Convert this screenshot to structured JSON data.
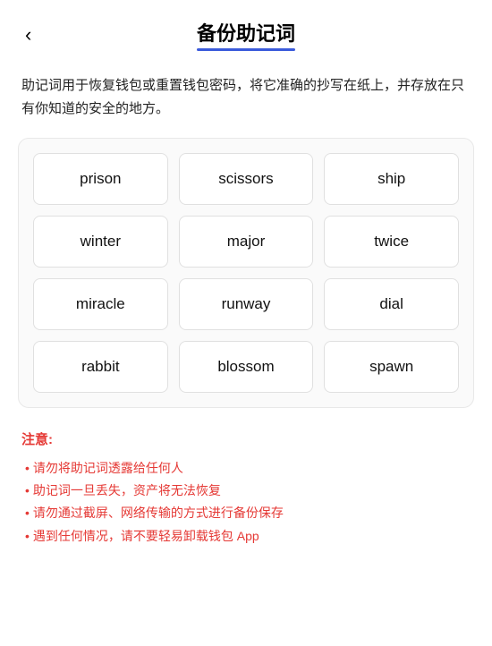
{
  "header": {
    "back_label": "‹",
    "title": "备份助记词"
  },
  "description": "助记词用于恢复钱包或重置钱包密码，将它准确的抄写在纸上，并存放在只有你知道的安全的地方。",
  "mnemonic": {
    "words": [
      "prison",
      "scissors",
      "ship",
      "winter",
      "major",
      "twice",
      "miracle",
      "runway",
      "dial",
      "rabbit",
      "blossom",
      "spawn"
    ]
  },
  "notice": {
    "title": "注意:",
    "items": [
      "请勿将助记词透露给任何人",
      "助记词一旦丢失，资产将无法恢复",
      "请勿通过截屏、网络传输的方式进行备份保存",
      "遇到任何情况，请不要轻易卸载钱包 App"
    ]
  }
}
